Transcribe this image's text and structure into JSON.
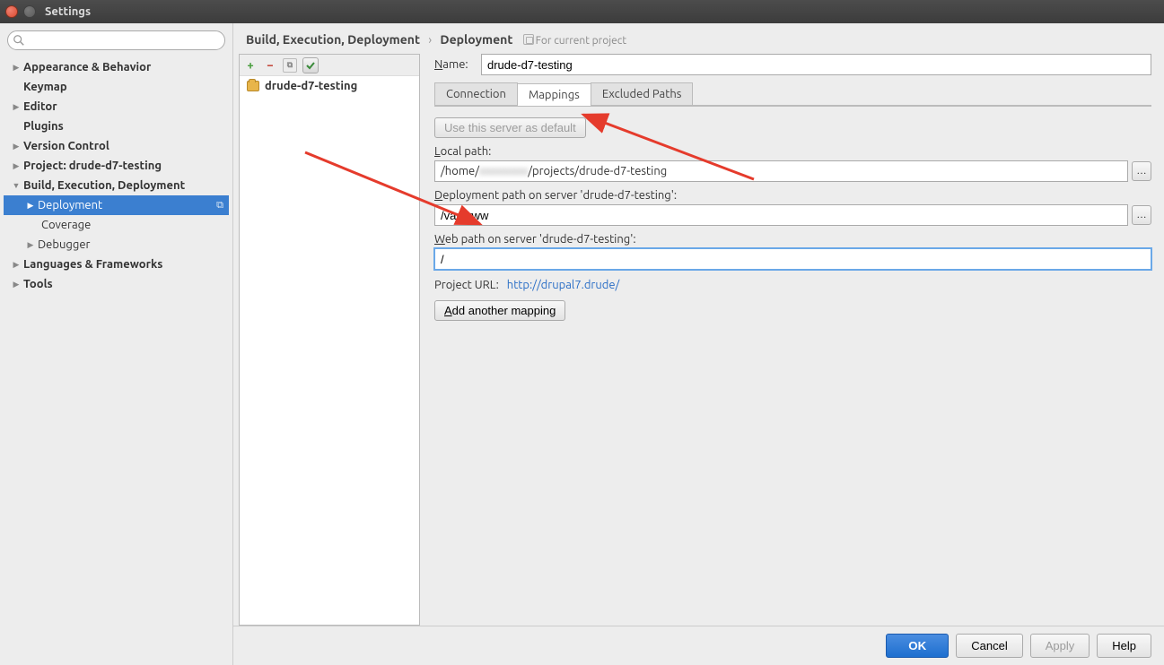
{
  "window": {
    "title": "Settings"
  },
  "search": {
    "placeholder": ""
  },
  "tree": {
    "appearance": "Appearance & Behavior",
    "keymap": "Keymap",
    "editor": "Editor",
    "plugins": "Plugins",
    "version_control": "Version Control",
    "project": "Project: drude-d7-testing",
    "build": "Build, Execution, Deployment",
    "deployment": "Deployment",
    "coverage": "Coverage",
    "debugger": "Debugger",
    "languages": "Languages & Frameworks",
    "tools": "Tools"
  },
  "breadcrumb": {
    "a": "Build, Execution, Deployment",
    "b": "Deployment",
    "note": "For current project"
  },
  "servers": {
    "item0": "drude-d7-testing"
  },
  "form": {
    "name_label": "Name:",
    "name_value": "drude-d7-testing",
    "tabs": {
      "connection": "Connection",
      "mappings": "Mappings",
      "excluded": "Excluded Paths"
    },
    "default_btn": "Use this server as default",
    "local_path_label": "Local path:",
    "local_path_value_pre": "/home/",
    "local_path_value_blur": "xxxxxxxx",
    "local_path_value_post": "/projects/drude-d7-testing",
    "deploy_path_label": "Deployment path on server 'drude-d7-testing':",
    "deploy_path_value": "/var/www",
    "web_path_label": "Web path on server 'drude-d7-testing':",
    "web_path_value": "/",
    "project_url_label": "Project URL:",
    "project_url": "http://drupal7.drude/",
    "add_mapping_btn": "Add another mapping"
  },
  "footer": {
    "ok": "OK",
    "cancel": "Cancel",
    "apply": "Apply",
    "help": "Help"
  }
}
